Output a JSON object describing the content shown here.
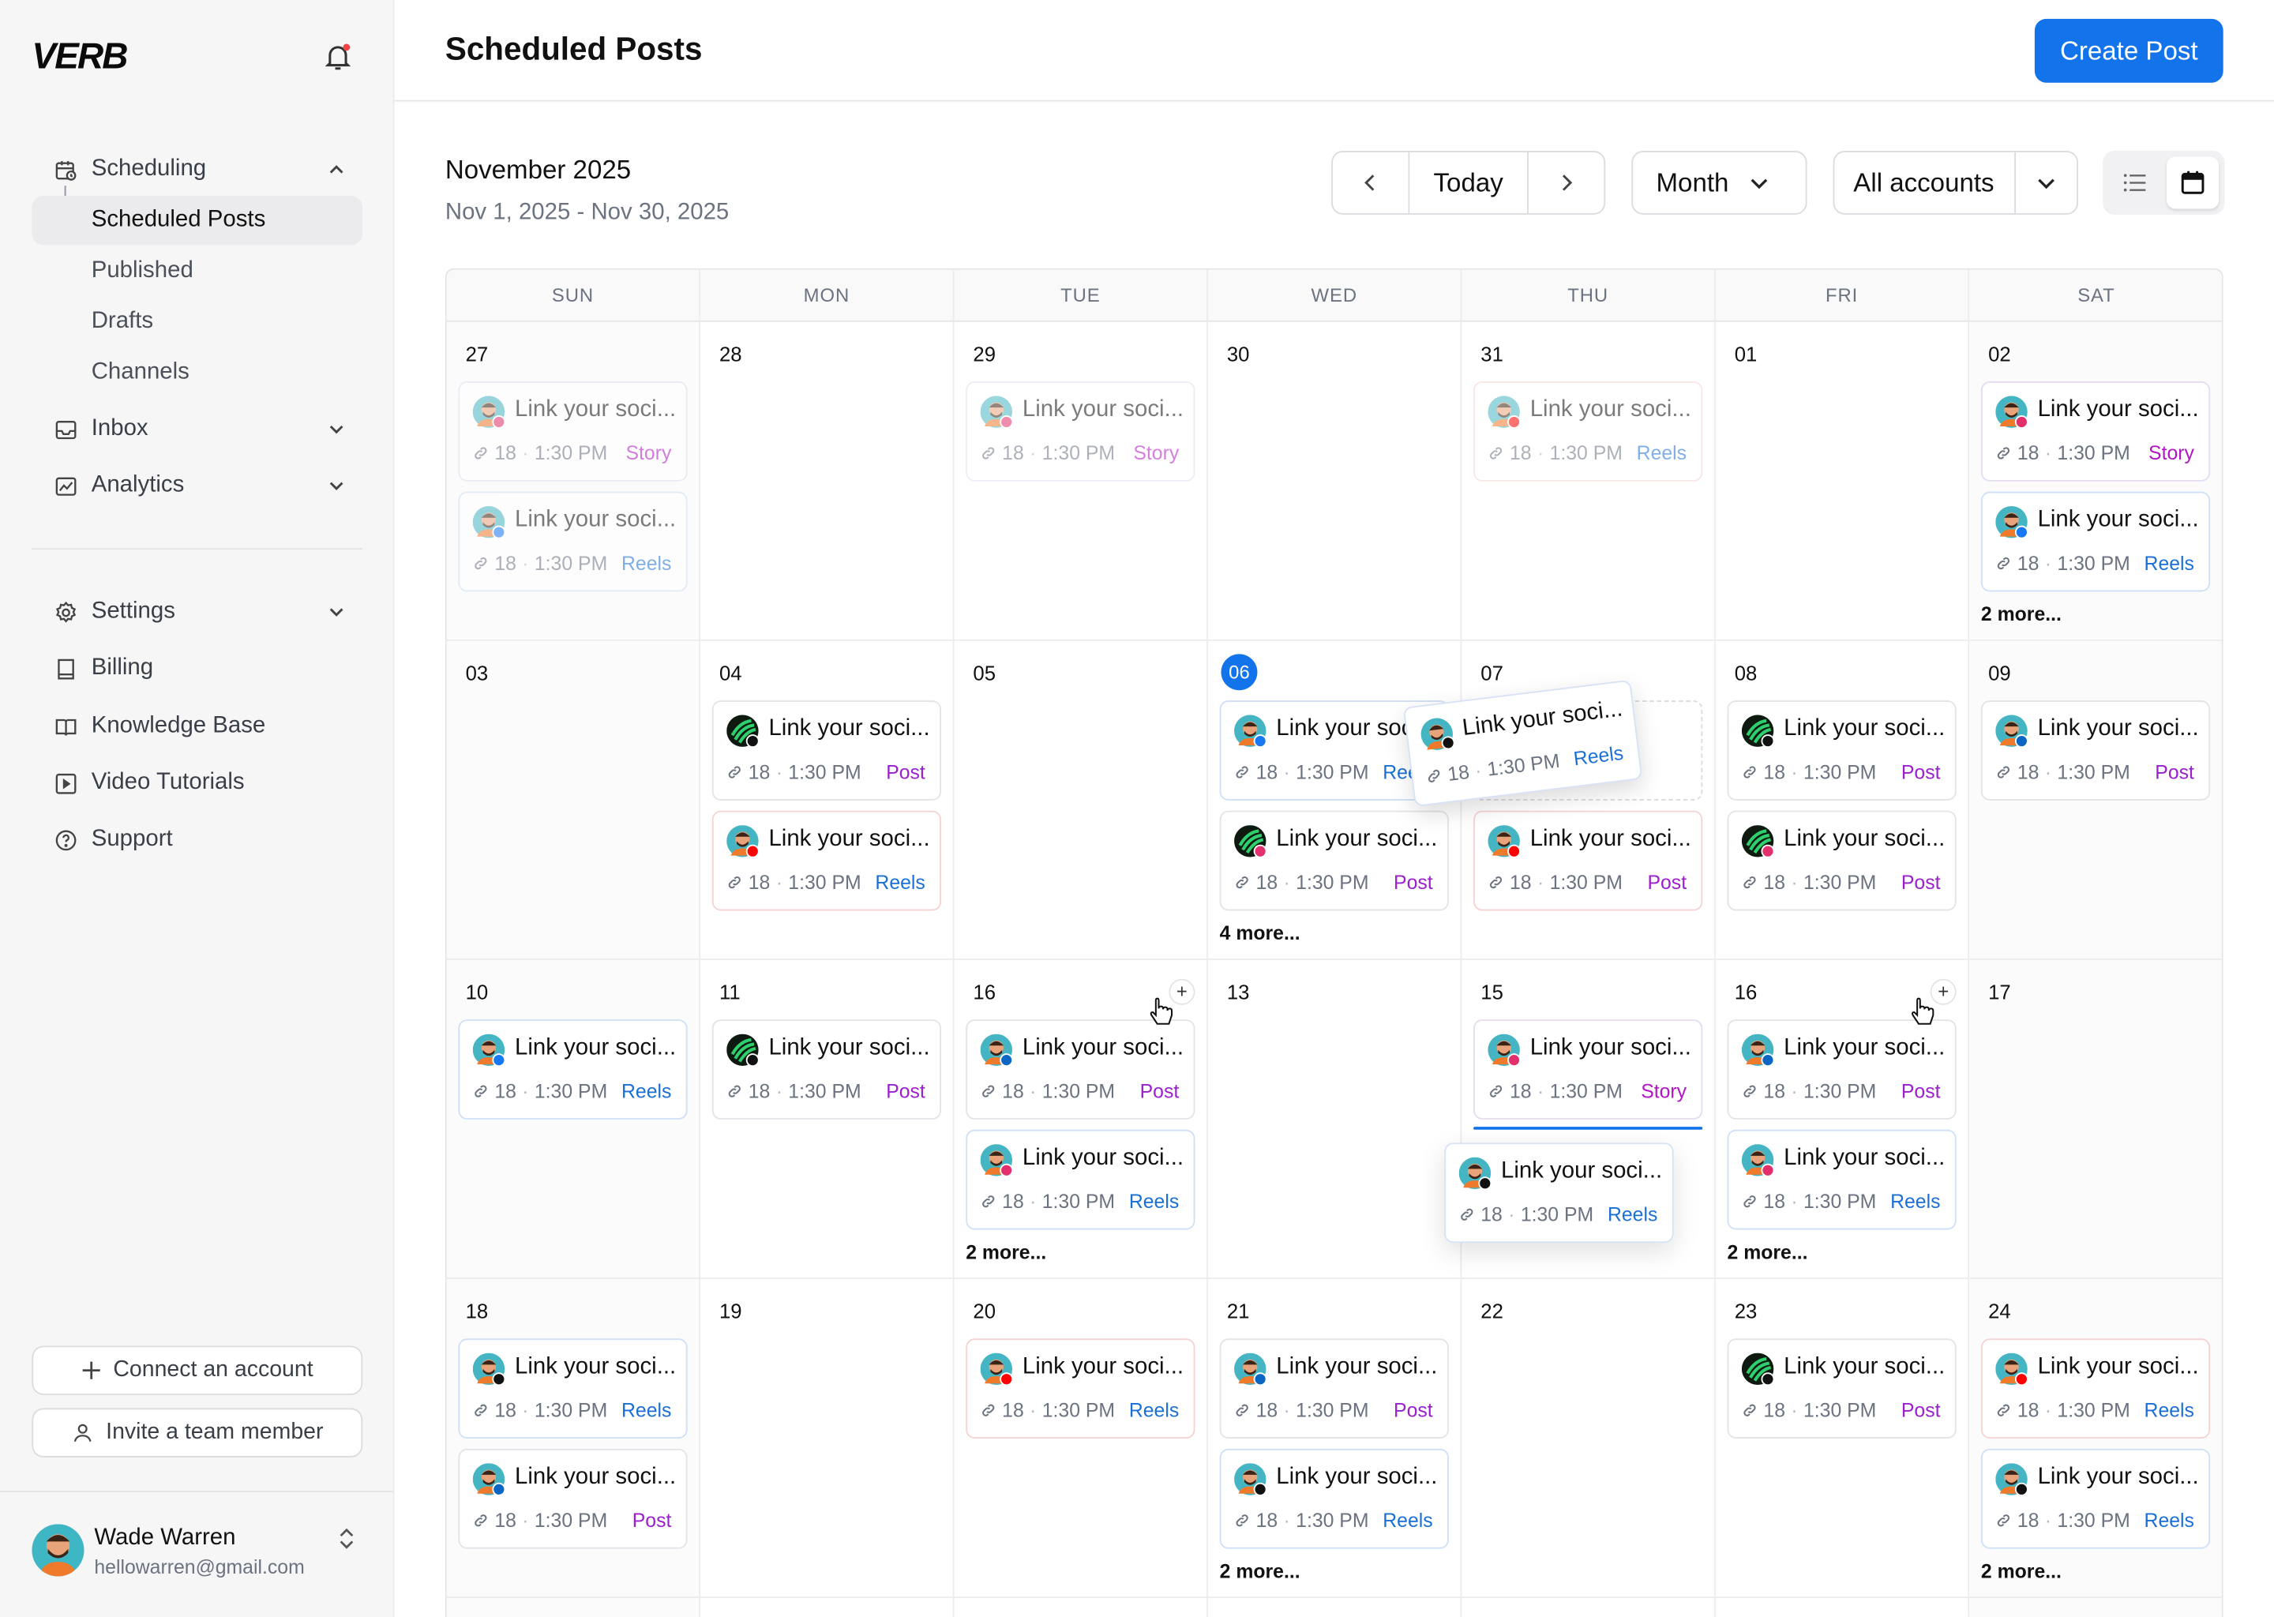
{
  "brand": "VERB",
  "colors": {
    "accent": "#1273eb",
    "post_tag": "#9b1fcf",
    "reels_tag": "#1a6fd6",
    "story_tag": "#b215c4"
  },
  "sidebar": {
    "scheduling": "Scheduling",
    "sub_items": [
      "Scheduled Posts",
      "Published",
      "Drafts",
      "Channels"
    ],
    "inbox": "Inbox",
    "analytics": "Analytics",
    "settings": "Settings",
    "billing": "Billing",
    "knowledge_base": "Knowledge Base",
    "video_tutorials": "Video Tutorials",
    "support": "Support",
    "connect_account": "Connect an account",
    "invite_member": "Invite a team member",
    "user_name": "Wade Warren",
    "user_email": "hellowarren@gmail.com"
  },
  "header": {
    "title": "Scheduled Posts",
    "create_button": "Create Post"
  },
  "toolbar": {
    "month_title": "November 2025",
    "range": "Nov 1, 2025 - Nov 30, 2025",
    "today": "Today",
    "view": "Month",
    "accounts": "All accounts"
  },
  "calendar": {
    "weekdays": [
      "SUN",
      "MON",
      "TUE",
      "WED",
      "THU",
      "FRI",
      "SAT"
    ],
    "post_text": "Link your soci...",
    "post_count": "18",
    "post_time": "1:30 PM",
    "weeks": [
      [
        {
          "day": "27",
          "faded": true,
          "posts": [
            {
              "tag": "Story",
              "net": "ig",
              "av": "man"
            },
            {
              "tag": "Reels",
              "net": "fb",
              "av": "man"
            }
          ]
        },
        {
          "day": "28",
          "faded": true,
          "posts": []
        },
        {
          "day": "29",
          "faded": true,
          "posts": [
            {
              "tag": "Story",
              "net": "ig",
              "av": "man"
            }
          ]
        },
        {
          "day": "30",
          "faded": true,
          "posts": []
        },
        {
          "day": "31",
          "faded": true,
          "posts": [
            {
              "tag": "Reels",
              "net": "yt",
              "av": "man"
            }
          ]
        },
        {
          "day": "01",
          "posts": []
        },
        {
          "day": "02",
          "posts": [
            {
              "tag": "Story",
              "net": "ig",
              "av": "man"
            },
            {
              "tag": "Reels",
              "net": "fb",
              "av": "man"
            }
          ],
          "more": "2 more..."
        }
      ],
      [
        {
          "day": "03",
          "posts": []
        },
        {
          "day": "04",
          "posts": [
            {
              "tag": "Post",
              "net": "tk",
              "av": "logo"
            },
            {
              "tag": "Reels",
              "net": "yt",
              "av": "man"
            }
          ]
        },
        {
          "day": "05",
          "posts": []
        },
        {
          "day": "06",
          "today": true,
          "posts": [
            {
              "tag": "Reels",
              "net": "fb",
              "av": "man"
            },
            {
              "tag": "Post",
              "net": "ig",
              "av": "logo"
            }
          ],
          "more": "4 more..."
        },
        {
          "day": "07",
          "posts": [
            {
              "tag": "",
              "net": "",
              "av": "",
              "placeholder": true
            },
            {
              "tag": "Post",
              "net": "yt",
              "av": "man"
            }
          ]
        },
        {
          "day": "08",
          "posts": [
            {
              "tag": "Post",
              "net": "tk",
              "av": "logo"
            },
            {
              "tag": "Post",
              "net": "ig",
              "av": "logo"
            }
          ]
        },
        {
          "day": "09",
          "posts": [
            {
              "tag": "Post",
              "net": "li",
              "av": "man"
            }
          ]
        }
      ],
      [
        {
          "day": "10",
          "posts": [
            {
              "tag": "Reels",
              "net": "fb",
              "av": "man"
            }
          ]
        },
        {
          "day": "11",
          "posts": [
            {
              "tag": "Post",
              "net": "tk",
              "av": "logo"
            }
          ]
        },
        {
          "day": "16",
          "posts": [
            {
              "tag": "Post",
              "net": "li",
              "av": "man"
            },
            {
              "tag": "Reels",
              "net": "ig",
              "av": "man"
            }
          ],
          "more": "2 more...",
          "plus": true
        },
        {
          "day": "13",
          "posts": []
        },
        {
          "day": "15",
          "posts": [
            {
              "tag": "Story",
              "net": "ig",
              "av": "man"
            }
          ]
        },
        {
          "day": "16",
          "posts": [
            {
              "tag": "Post",
              "net": "li",
              "av": "man"
            },
            {
              "tag": "Reels",
              "net": "ig",
              "av": "man"
            }
          ],
          "more": "2 more...",
          "plus": true
        },
        {
          "day": "17",
          "posts": []
        }
      ],
      [
        {
          "day": "18",
          "posts": [
            {
              "tag": "Reels",
              "net": "tk",
              "av": "man"
            },
            {
              "tag": "Post",
              "net": "li",
              "av": "man"
            }
          ]
        },
        {
          "day": "19",
          "posts": []
        },
        {
          "day": "20",
          "posts": [
            {
              "tag": "Reels",
              "net": "yt",
              "av": "man"
            }
          ]
        },
        {
          "day": "21",
          "posts": [
            {
              "tag": "Post",
              "net": "li",
              "av": "man"
            },
            {
              "tag": "Reels",
              "net": "tk",
              "av": "man"
            }
          ],
          "more": "2 more..."
        },
        {
          "day": "22",
          "posts": []
        },
        {
          "day": "23",
          "posts": [
            {
              "tag": "Post",
              "net": "tk",
              "av": "logo"
            }
          ]
        },
        {
          "day": "24",
          "posts": [
            {
              "tag": "Reels",
              "net": "yt",
              "av": "man"
            },
            {
              "tag": "Reels",
              "net": "tk",
              "av": "man"
            }
          ],
          "more": "2 more..."
        }
      ]
    ],
    "floating": [
      {
        "tag": "Reels",
        "net": "tk",
        "av": "man"
      },
      {
        "tag": "Reels",
        "net": "tk",
        "av": "man"
      }
    ]
  }
}
